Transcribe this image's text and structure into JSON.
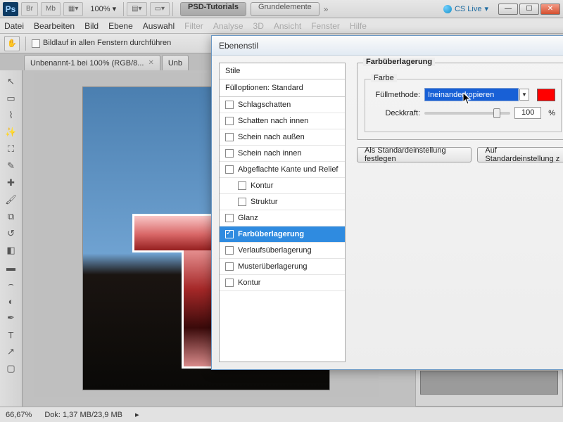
{
  "topbar": {
    "ps": "Ps",
    "br": "Br",
    "mb": "Mb",
    "zoom": "100%",
    "crumb_active": "PSD-Tutorials",
    "crumb_inactive": "Grundelemente",
    "cs_live": "CS Live"
  },
  "menu": {
    "items": [
      "Datei",
      "Bearbeiten",
      "Bild",
      "Ebene",
      "Auswahl",
      "Filter",
      "Analyse",
      "3D",
      "Ansicht",
      "Fenster",
      "Hilfe"
    ]
  },
  "options": {
    "scroll_all": "Bildlauf in allen Fenstern durchführen"
  },
  "tab": {
    "title": "Unbenannt-1 bei 100% (RGB/8...",
    "title2": "Unb"
  },
  "status": {
    "zoom": "66,67%",
    "doc": "Dok: 1,37 MB/23,9 MB"
  },
  "dialog": {
    "title": "Ebenenstil",
    "styles_header": "Stile",
    "blend_options": "Fülloptionen: Standard",
    "items": {
      "drop_shadow": "Schlagschatten",
      "inner_shadow": "Schatten nach innen",
      "outer_glow": "Schein nach außen",
      "inner_glow": "Schein nach innen",
      "bevel": "Abgeflachte Kante und Relief",
      "contour": "Kontur",
      "texture": "Struktur",
      "satin": "Glanz",
      "color_overlay": "Farbüberlagerung",
      "gradient_overlay": "Verlaufsüberlagerung",
      "pattern_overlay": "Musterüberlagerung",
      "stroke": "Kontur"
    },
    "section_title": "Farbüberlagerung",
    "subsection": "Farbe",
    "blend_label": "Füllmethode:",
    "blend_value": "Ineinanderkopieren",
    "opacity_label": "Deckkraft:",
    "opacity_value": "100",
    "opacity_unit": "%",
    "make_default": "Als Standardeinstellung festlegen",
    "reset_default": "Auf Standardeinstellung z"
  }
}
